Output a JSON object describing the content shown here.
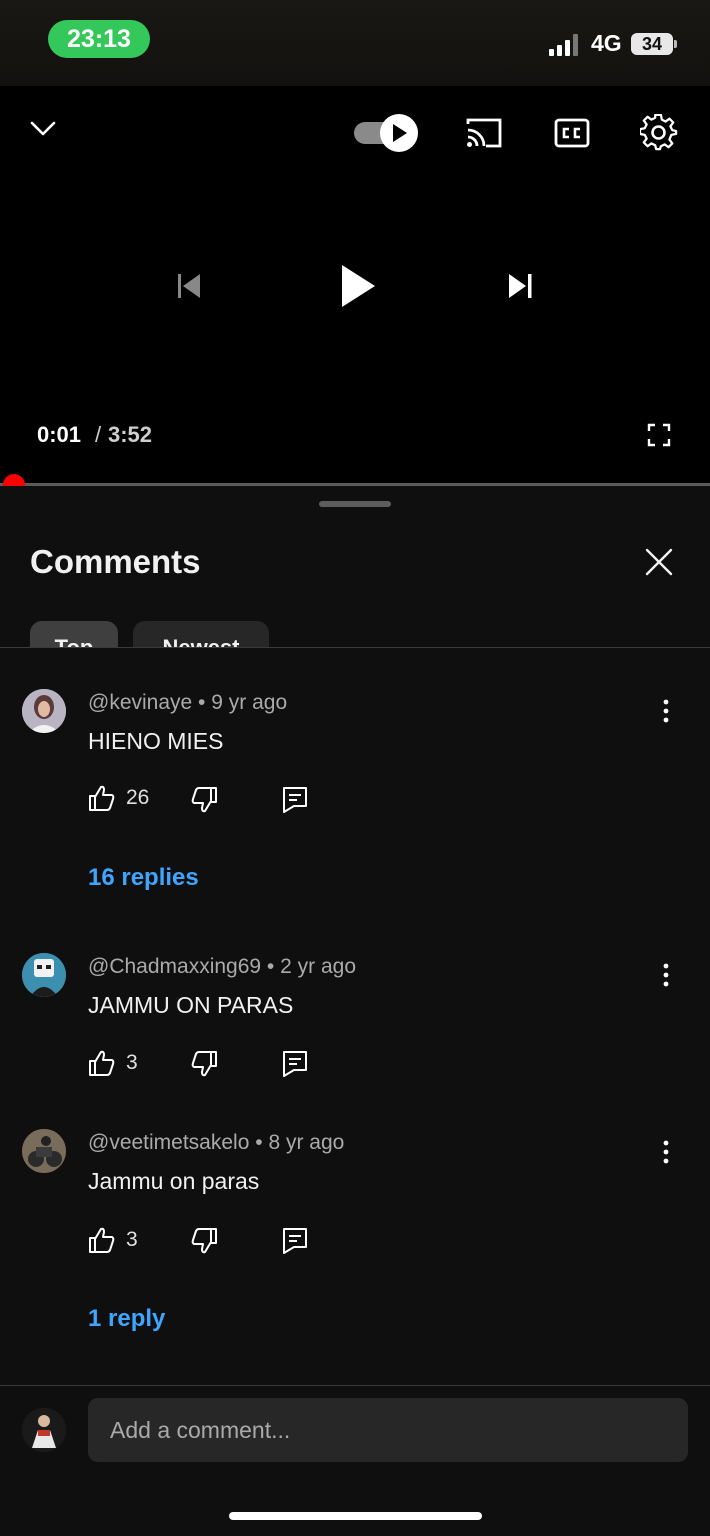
{
  "status_bar": {
    "time": "23:13",
    "network": "4G",
    "battery": "34"
  },
  "player": {
    "current_time": "0:01",
    "separator": "/",
    "duration": "3:52",
    "progress_fraction": 0.004,
    "autoplay_on": true
  },
  "comments_panel": {
    "title": "Comments",
    "chips": [
      "Top",
      "Newest"
    ],
    "selected_chip": "Top",
    "items": [
      {
        "author": "@kevinaye",
        "age": "9 yr ago",
        "text": "HIENO MIES",
        "likes": "26",
        "replies": "16 replies"
      },
      {
        "author": "@Chadmaxxing69",
        "age": "2 yr ago",
        "text": "JAMMU ON PARAS",
        "likes": "3",
        "replies": ""
      },
      {
        "author": "@veetimetsakelo",
        "age": "8 yr ago",
        "text": "Jammu on paras",
        "likes": "3",
        "replies": "1 reply"
      }
    ],
    "dot": "•",
    "add_comment_placeholder": "Add a comment..."
  },
  "colors": {
    "accent_blue": "#3ea6ff",
    "progress_red": "#ff0000",
    "status_green": "#34c759"
  }
}
